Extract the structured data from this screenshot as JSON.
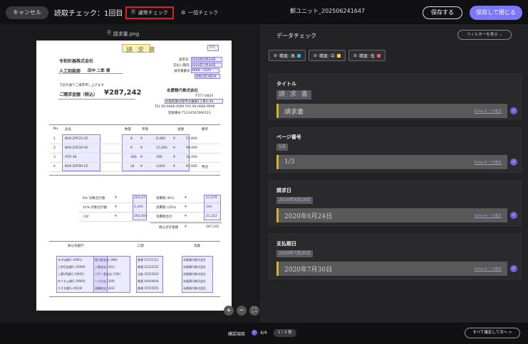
{
  "header": {
    "cancel": "キャンセル",
    "title": "読取チェック：1回目",
    "tab_normal": "通常チェック",
    "tab_bulk": "一括チェック",
    "doc": "郵ユニット_202506241647",
    "save": "保存する",
    "save_close": "保存して閉じる"
  },
  "viewer": {
    "filename": "請求書.png"
  },
  "invoice": {
    "title": "請 求 書",
    "page_tag": "1/3",
    "company": "令和計器株式会社",
    "dept": "人工知能部",
    "person": "田中 二郎 様",
    "issue_label": "請求日",
    "issue_date": "2020年6月24日",
    "due_label": "支払い期日",
    "due_date": "2020年7月30日",
    "no_label": "請求書番号",
    "no": "4466 - 1225",
    "ref": "令和3年3月29",
    "intro": "下記の通りご請求申し上げます",
    "amount_label": "ご請求金額（税込）",
    "amount": "¥287,242",
    "seller": "永愛精巧株式会社",
    "zip": "〒577-0824",
    "address": "大阪府東大阪市大蓮東1丁目3-39",
    "tel": "TEL 06-6666-0000 FAX 06-6666-9999",
    "reg": "登録番号 T1234567890123",
    "cols": [
      "No.",
      "品名",
      "数量",
      "単価",
      "",
      "金額",
      "備考"
    ],
    "rows": [
      [
        "1",
        "BOX-ZAT25-35",
        "8",
        "¥",
        "6,480",
        "¥",
        "51,840",
        ""
      ],
      [
        "2",
        "BOX-ZAT28-50",
        "6",
        "¥",
        "15,000",
        "¥",
        "90,000",
        ""
      ],
      [
        "3",
        "ATO-38",
        "180",
        "¥",
        "180",
        "¥",
        "32,400",
        ""
      ],
      [
        "4",
        "BOX-ZAT80-25",
        "24",
        "¥",
        "3,820",
        "¥",
        "91,680",
        "特注"
      ]
    ],
    "sum": [
      [
        "8% 対象合計額",
        "¥",
        "263,472",
        "消費税 (8%)",
        "¥",
        "21,078"
      ],
      [
        "10% 対象合計額",
        "¥",
        "2,445",
        "消費税 (10%)",
        "¥",
        "244"
      ],
      [
        "小計",
        "¥",
        "265,920",
        "消費税合計",
        "¥",
        "21,322"
      ]
    ],
    "total_label": "税込合計金額",
    "total": "287,242",
    "bank_cols": [
      "振込先銀行",
      "口座",
      "名義"
    ],
    "banks": [
      [
        "みずほ銀行 (0001)",
        "東大阪支店 (484)",
        "普通 11111111",
        "永愛精巧株式会社"
      ],
      [
        "三井住友銀行 (0009)",
        "八尾支店 (161)",
        "普通 22222222",
        "永愛精巧株式会社"
      ],
      [
        "三菱UFJ銀行 (0005)",
        "八戸ノ里支店 (156)",
        "当座 33333333",
        "永愛精巧株式会社"
      ],
      [
        "ゆうちょ銀行 (9900)",
        "一六九店 (169)",
        "普通 44444444",
        "永愛精巧株式会社"
      ],
      [
        "りそな銀行 (0010)",
        "長瀬支店 (422)",
        "普通 55555555",
        "永愛精巧株式会社"
      ]
    ]
  },
  "panel": {
    "title": "データチェック",
    "filter": "フィルターを表示 ⌄",
    "chips": [
      {
        "label": "精度: 高",
        "color": "#3ab7c8"
      },
      {
        "label": "精度: 中",
        "color": "#e8d24a"
      },
      {
        "label": "精度: 低",
        "color": "#e45a6a"
      }
    ],
    "hint": "Enterキーで確定",
    "fields": [
      {
        "label": "タイトル",
        "crop": "請 求 書",
        "value": "請求書"
      },
      {
        "label": "ページ番号",
        "crop": "1/3",
        "value": "1/3"
      },
      {
        "label": "請求日",
        "crop": "2020年6月24日",
        "value": "2020年6月24日"
      },
      {
        "label": "支払期日",
        "crop": "2020年7月30日",
        "value": "2020年7月30日"
      }
    ]
  },
  "footer": {
    "label": "確認項目",
    "count": "4/4",
    "page": "1 / 3 枚",
    "next": "すべて確定して次へ >"
  }
}
